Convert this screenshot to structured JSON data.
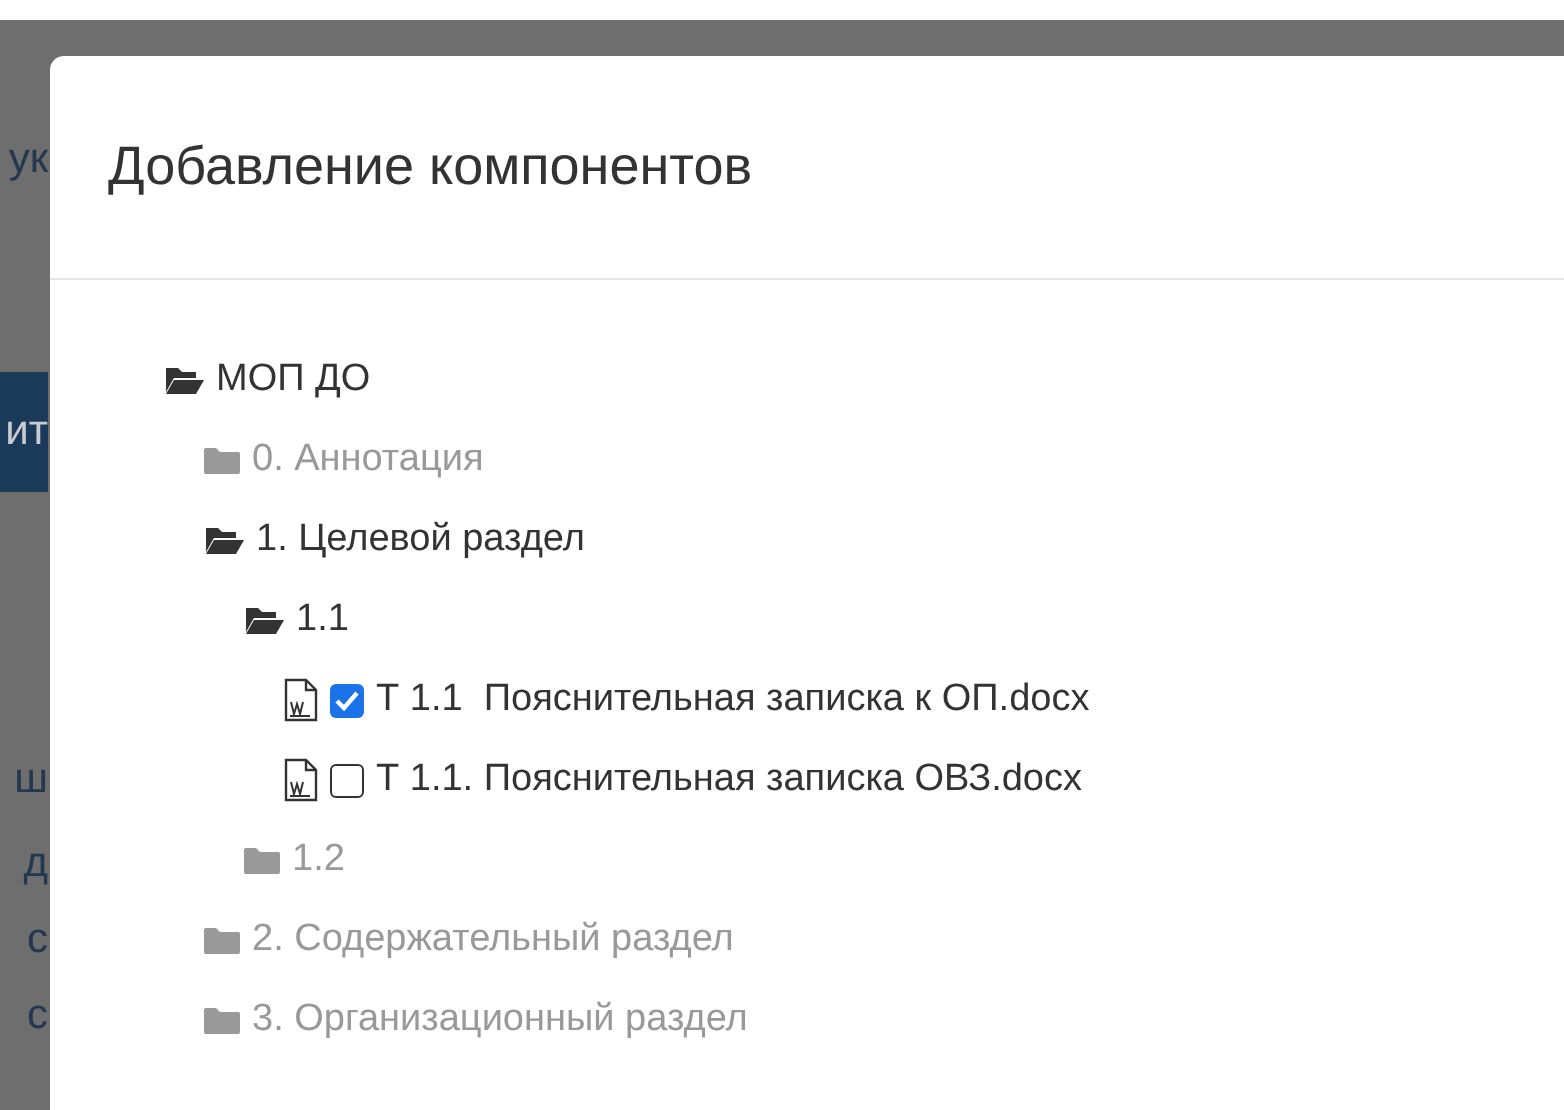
{
  "background": {
    "fragments": [
      {
        "text": "ук",
        "kind": "plain"
      },
      {
        "text": "ит",
        "kind": "header"
      },
      {
        "text": "ш",
        "kind": "plain"
      },
      {
        "text": "д",
        "kind": "plain"
      },
      {
        "text": "с",
        "kind": "plain"
      },
      {
        "text": "с",
        "kind": "plain"
      }
    ]
  },
  "dialog": {
    "title": "Добавление компонентов",
    "tree": [
      {
        "kind": "folder",
        "label": "МОП ДО",
        "expanded": true,
        "children": [
          {
            "kind": "folder",
            "label": "0. Аннотация",
            "expanded": false
          },
          {
            "kind": "folder",
            "label": "1. Целевой раздел",
            "expanded": true,
            "children": [
              {
                "kind": "folder",
                "label": "1.1",
                "expanded": true,
                "children": [
                  {
                    "kind": "file",
                    "label": "Т 1.1  Пояснительная записка к ОП.docx",
                    "checked": true
                  },
                  {
                    "kind": "file",
                    "label": "Т 1.1. Пояснительная записка ОВЗ.docx",
                    "checked": false
                  }
                ]
              },
              {
                "kind": "folder",
                "label": "1.2",
                "expanded": false
              }
            ]
          },
          {
            "kind": "folder",
            "label": "2. Содержательный раздел",
            "expanded": false
          },
          {
            "kind": "folder",
            "label": "3. Организационный раздел",
            "expanded": false
          }
        ]
      }
    ]
  }
}
